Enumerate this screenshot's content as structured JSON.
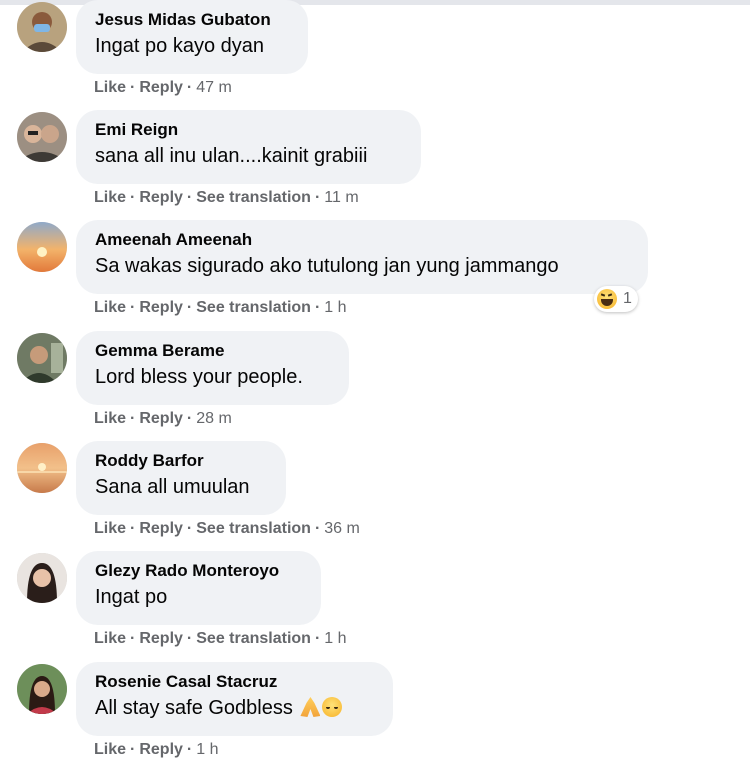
{
  "comments": [
    {
      "author": "Jesus Midas Gubaton",
      "text": "Ingat po kayo dyan",
      "like": "Like",
      "reply": "Reply",
      "time": "47 m"
    },
    {
      "author": "Emi Reign",
      "text": "sana all inu ulan....kainit grabiii",
      "like": "Like",
      "reply": "Reply",
      "translate": "See translation",
      "time": "11 m"
    },
    {
      "author": "Ameenah Ameenah",
      "text": "Sa wakas sigurado ako tutulong jan yung jammango",
      "like": "Like",
      "reply": "Reply",
      "translate": "See translation",
      "time": "1 h",
      "reaction_icon": "haha-emoji-icon",
      "reaction_count": "1"
    },
    {
      "author": "Gemma Berame",
      "text": "Lord bless your people.",
      "like": "Like",
      "reply": "Reply",
      "time": "28 m"
    },
    {
      "author": "Roddy Barfor",
      "text": "Sana all umuulan",
      "like": "Like",
      "reply": "Reply",
      "translate": "See translation",
      "time": "36 m"
    },
    {
      "author": "Glezy Rado Monteroyo",
      "text": "Ingat po",
      "like": "Like",
      "reply": "Reply",
      "translate": "See translation",
      "time": "1 h"
    },
    {
      "author": "Rosenie Casal Stacruz",
      "text": "All stay safe Godbless",
      "like": "Like",
      "reply": "Reply",
      "time": "1 h",
      "emojis": [
        "folded-hands-emoji-icon",
        "relieved-face-emoji-icon"
      ]
    }
  ],
  "colors": {
    "bubble": "#f0f2f5",
    "meta_text": "#65676b",
    "name_text": "#050505"
  }
}
